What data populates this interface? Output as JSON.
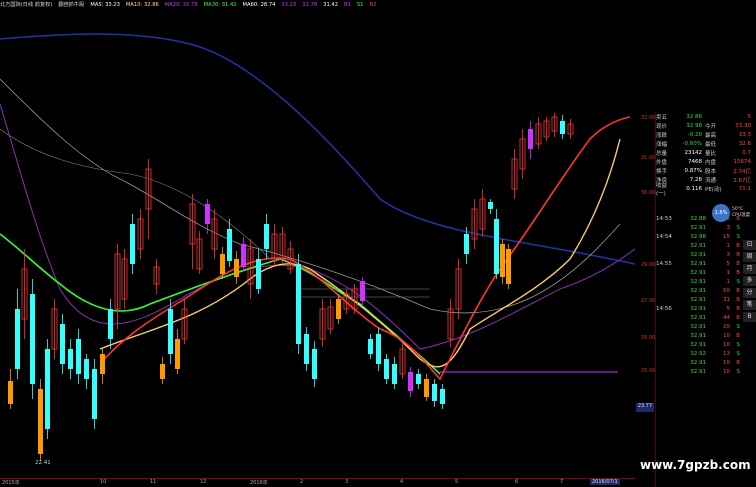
{
  "topbar": {
    "title": "北方国际(日线 前复权)",
    "indicator": "翻倍抓牛股",
    "ma5": "MA5: 33.23",
    "ma10": "MA10: 32.86",
    "ma20": "MA20: 32.78",
    "ma30": "MA30: 31.42",
    "ma60": "MA60: 28.74",
    "extra1": "33.23",
    "extra2": "32.78",
    "extra3": "31.42",
    "extra4": "B1",
    "extra5": "S1",
    "extra6": "B2"
  },
  "chart": {
    "low_label": "22.41",
    "colors": {
      "up": "#ff3333",
      "down": "#33ffff",
      "purple": "#cc33ff",
      "orange": "#ff9900",
      "ma_yellow": "#ffe066",
      "ma_green": "#33ff33",
      "ma_blue": "#3333aa"
    }
  },
  "price_axis": [
    "32.00",
    "31.00",
    "30.00",
    "29.00",
    "27.00",
    "26.00",
    "25.00"
  ],
  "date_axis": [
    "2015年",
    "10",
    "11",
    "12",
    "2016年",
    "2",
    "3",
    "4",
    "5",
    "6",
    "7",
    "2016/07/1"
  ],
  "quote": {
    "rows": [
      {
        "k": "卖五",
        "v1": "32.86",
        "k2": "",
        "v2": "5"
      },
      {
        "k": "现价",
        "v1": "32.98",
        "k2": "今开",
        "v2": "33.30"
      },
      {
        "k": "涨跌",
        "v1": "-0.20",
        "k2": "最高",
        "v2": "33.3"
      },
      {
        "k": "涨幅",
        "v1": "-0.60%",
        "k2": "最低",
        "v2": "32.6"
      },
      {
        "k": "总量",
        "v1": "23142",
        "k2": "量比",
        "v2": "0.7"
      },
      {
        "k": "外盘",
        "v1": "7468",
        "k2": "内盘",
        "v2": "15674"
      },
      {
        "k": "换手",
        "v1": "0.87%",
        "k2": "股本",
        "v2": "2.74亿"
      },
      {
        "k": "净资",
        "v1": "7.28",
        "k2": "流通",
        "v2": "2.67亿"
      },
      {
        "k": "收益(一)",
        "v1": "0.116",
        "k2": "PE(动)",
        "v2": "71.1"
      }
    ],
    "ticks": [
      {
        "t": "14:53",
        "p": "32.88",
        "vol": "5",
        "bs": "B"
      },
      {
        "t": "",
        "p": "32.91",
        "vol": "3",
        "bs": "S"
      },
      {
        "t": "14:54",
        "p": "32.98",
        "vol": "15",
        "bs": "S"
      },
      {
        "t": "",
        "p": "32.91",
        "vol": "1",
        "bs": "B"
      },
      {
        "t": "",
        "p": "32.91",
        "vol": "3",
        "bs": "B"
      },
      {
        "t": "14:55",
        "p": "32.91",
        "vol": "5",
        "bs": "B"
      },
      {
        "t": "",
        "p": "32.91",
        "vol": "1",
        "bs": "B"
      },
      {
        "t": "",
        "p": "32.91",
        "vol": "1",
        "bs": "S"
      },
      {
        "t": "",
        "p": "32.91",
        "vol": "50",
        "bs": "B"
      },
      {
        "t": "",
        "p": "32.91",
        "vol": "31",
        "bs": "B"
      },
      {
        "t": "14:56",
        "p": "32.91",
        "vol": "5",
        "bs": "B"
      },
      {
        "t": "",
        "p": "32.91",
        "vol": "44",
        "bs": "B"
      },
      {
        "t": "",
        "p": "32.91",
        "vol": "20",
        "bs": "S"
      },
      {
        "t": "",
        "p": "32.91",
        "vol": "10",
        "bs": "B"
      },
      {
        "t": "",
        "p": "32.91",
        "vol": "10",
        "bs": "S"
      },
      {
        "t": "",
        "p": "32.92",
        "vol": "13",
        "bs": "S"
      },
      {
        "t": "",
        "p": "32.91",
        "vol": "10",
        "bs": "B"
      },
      {
        "t": "",
        "p": "32.91",
        "vol": "10",
        "bs": "S"
      }
    ]
  },
  "cpu": {
    "value": "1.8%",
    "temp": "50°C",
    "label": "CPU温度"
  },
  "volume_box": "23.77",
  "tools": [
    "日",
    "周",
    "月",
    "多",
    "分",
    "笔",
    "B"
  ],
  "watermark": "www.7gpzb.com"
}
